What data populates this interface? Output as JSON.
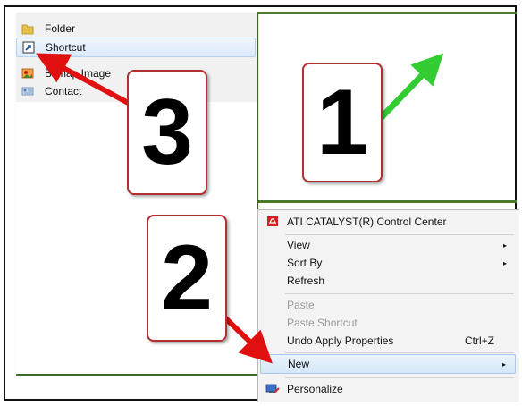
{
  "submenu": {
    "items": [
      {
        "label": "Folder",
        "icon": "folder-icon"
      },
      {
        "label": "Shortcut",
        "icon": "shortcut-icon"
      },
      {
        "label": "Bitmap Image",
        "icon": "bitmap-image-icon"
      },
      {
        "label": "Contact",
        "icon": "contact-icon"
      }
    ]
  },
  "context_menu": {
    "header": {
      "label": "ATI CATALYST(R) Control Center",
      "icon": "ati-logo-icon"
    },
    "view": "View",
    "sort_by": "Sort By",
    "refresh": "Refresh",
    "paste": "Paste",
    "paste_shortcut": "Paste Shortcut",
    "undo": "Undo Apply Properties",
    "undo_shortcut": "Ctrl+Z",
    "new": "New",
    "personalize": {
      "label": "Personalize",
      "icon": "personalize-icon"
    },
    "submenu_arrow": "▸"
  },
  "callouts": {
    "one": "1",
    "two": "2",
    "three": "3"
  },
  "colors": {
    "callout_border": "#b03030",
    "arrow_red": "#e01010",
    "arrow_green": "#33cc33",
    "highlight": "#d6e7f9"
  }
}
